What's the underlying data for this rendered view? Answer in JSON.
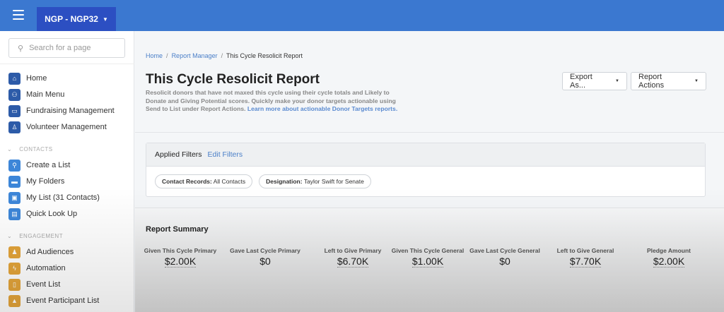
{
  "topbar": {
    "org_label": "NGP - NGP32"
  },
  "sidebar": {
    "search_placeholder": "Search for a page",
    "main_items": [
      {
        "label": "Home"
      },
      {
        "label": "Main Menu"
      },
      {
        "label": "Fundraising Management"
      },
      {
        "label": "Volunteer Management"
      }
    ],
    "contacts_header": "CONTACTS",
    "contacts_items": [
      {
        "label": "Create a List"
      },
      {
        "label": "My Folders"
      },
      {
        "label": "My List (31 Contacts)"
      },
      {
        "label": "Quick Look Up"
      }
    ],
    "engagement_header": "ENGAGEMENT",
    "engagement_items": [
      {
        "label": "Ad Audiences"
      },
      {
        "label": "Automation"
      },
      {
        "label": "Event List"
      },
      {
        "label": "Event Participant List"
      }
    ]
  },
  "breadcrumb": {
    "home": "Home",
    "sep": "/",
    "manager": "Report Manager",
    "current": "This Cycle Resolicit Report"
  },
  "page": {
    "title": "This Cycle Resolicit Report",
    "description": "Resolicit donors that have not maxed this cycle using their cycle totals and Likely to Donate and Giving Potential scores. Quickly make your donor targets actionable using Send to List under Report Actions. ",
    "learn_more": "Learn more about actionable Donor Targets reports.",
    "export_label": "Export As...",
    "actions_label": "Report Actions"
  },
  "filters": {
    "title": "Applied Filters",
    "edit": "Edit Filters",
    "chips": [
      {
        "key": "Contact Records:",
        "value": "All Contacts"
      },
      {
        "key": "Designation:",
        "value": "Taylor Swift for Senate"
      }
    ]
  },
  "summary": {
    "title": "Report Summary",
    "metrics": [
      {
        "label": "Given This Cycle Primary",
        "value": "$2.00K"
      },
      {
        "label": "Gave Last Cycle Primary",
        "value": "$0"
      },
      {
        "label": "Left to Give Primary",
        "value": "$6.70K"
      },
      {
        "label": "Given This Cycle General",
        "value": "$1.00K"
      },
      {
        "label": "Gave Last Cycle General",
        "value": "$0"
      },
      {
        "label": "Left to Give General",
        "value": "$7.70K"
      },
      {
        "label": "Pledge Amount",
        "value": "$2.00K"
      }
    ]
  }
}
